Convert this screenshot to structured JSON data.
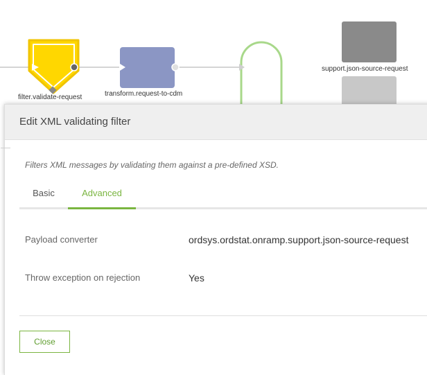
{
  "flow": {
    "nodes": {
      "filter_label": "filter.validate-request",
      "transform_label": "transform.request-to-cdm",
      "support_label": "support.json-source-request"
    }
  },
  "dialog": {
    "title": "Edit XML validating filter",
    "description": "Filters XML messages by validating them against a pre-defined XSD.",
    "tabs": [
      {
        "label": "Basic"
      },
      {
        "label": "Advanced"
      }
    ],
    "active_tab": "Advanced",
    "properties": [
      {
        "label": "Payload converter",
        "value": "ordsys.ordstat.onramp.support.json-source-request"
      },
      {
        "label": "Throw exception on rejection",
        "value": "Yes"
      }
    ],
    "close_label": "Close"
  },
  "colors": {
    "accent": "#7ab540",
    "filter_node": "#ffd700",
    "transform_node": "#8b96c4",
    "support_node": "#8a8a8a",
    "loop_node": "#a8d88a"
  }
}
